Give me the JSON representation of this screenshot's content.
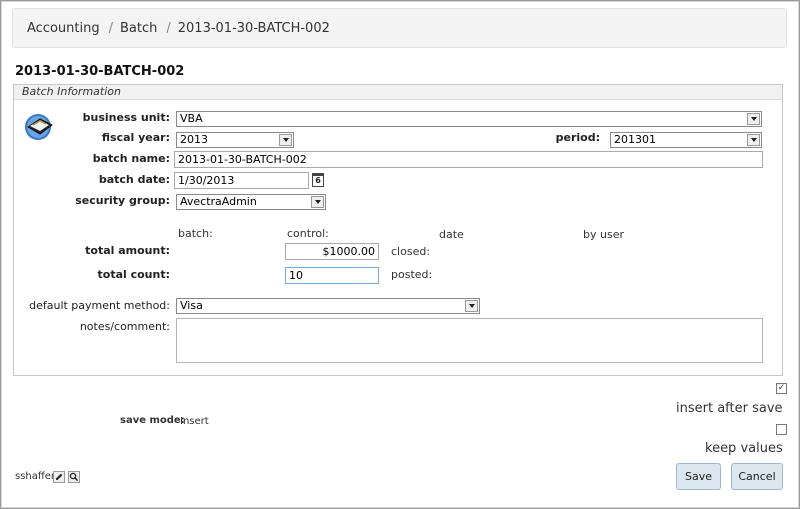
{
  "breadcrumb": {
    "items": [
      "Accounting",
      "Batch",
      "2013-01-30-BATCH-002"
    ],
    "separator": "/"
  },
  "page_title": "2013-01-30-BATCH-002",
  "section": {
    "legend": "Batch Information",
    "labels": {
      "business_unit": "business unit:",
      "fiscal_year": "fiscal year:",
      "period": "period:",
      "batch_name": "batch name:",
      "batch_date": "batch date:",
      "security_group": "security group:",
      "total_amount": "total amount:",
      "total_count": "total count:",
      "default_payment_method": "default payment method:",
      "notes_comment": "notes/comment:"
    },
    "values": {
      "business_unit": "VBA",
      "fiscal_year": "2013",
      "period": "201301",
      "batch_name": "2013-01-30-BATCH-002",
      "batch_date": "1/30/2013",
      "security_group": "AvectraAdmin",
      "total_amount": "$1000.00",
      "total_count": "10",
      "default_payment_method": "Visa",
      "notes_comment": ""
    },
    "calendar_icon_text": "6",
    "columns": {
      "batch": "batch:",
      "control": "control:",
      "date": "date",
      "by_user": "by user"
    },
    "status": {
      "closed": "closed:",
      "posted": "posted:"
    }
  },
  "footer": {
    "save_mode_label": "save mode:",
    "save_mode_value": "Insert",
    "insert_after_save": {
      "label": "insert after save",
      "checked": true,
      "mark": "✓"
    },
    "keep_values": {
      "label": "keep values",
      "checked": false,
      "mark": ""
    },
    "user": "sshaffer",
    "buttons": {
      "save": "Save",
      "cancel": "Cancel"
    }
  },
  "icons": [
    "batch-icon",
    "calendar-icon",
    "pencil-icon",
    "magnifier-icon",
    "dropdown-arrow-icon"
  ]
}
